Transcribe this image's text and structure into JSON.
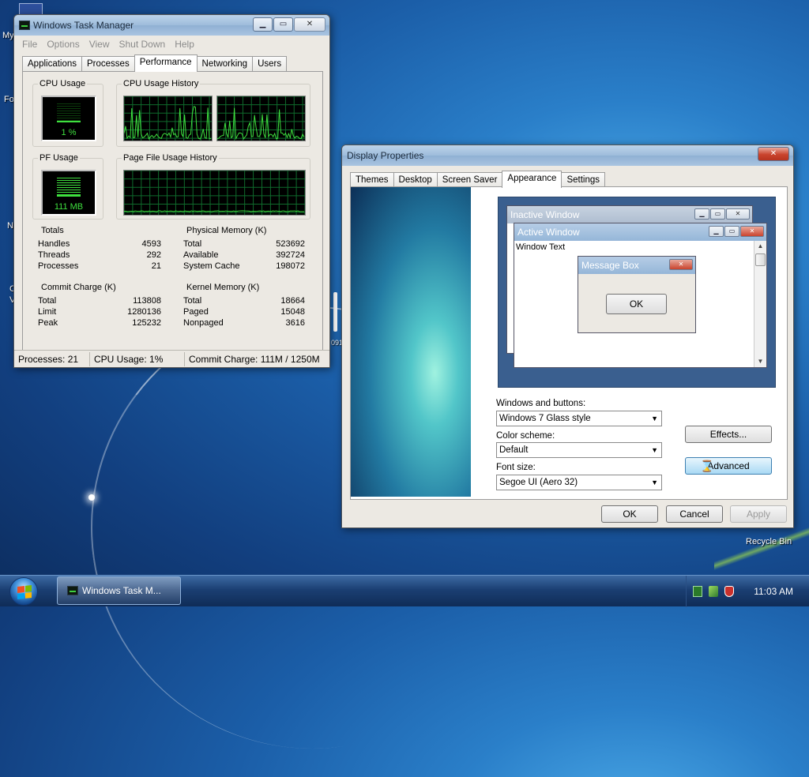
{
  "desktop": {
    "side_labels": [
      "My",
      "Fo",
      "N",
      "C",
      "V"
    ],
    "gadget_text": "091",
    "recycle_bin": "Recycle Bin"
  },
  "task_manager": {
    "title": "Windows Task Manager",
    "menu": [
      "File",
      "Options",
      "View",
      "Shut Down",
      "Help"
    ],
    "tabs": [
      "Applications",
      "Processes",
      "Performance",
      "Networking",
      "Users"
    ],
    "active_tab": "Performance",
    "cpu_usage_label": "CPU Usage",
    "cpu_usage_value": "1 %",
    "cpu_history_label": "CPU Usage History",
    "pf_usage_label": "PF Usage",
    "pf_usage_value": "111 MB",
    "pf_history_label": "Page File Usage History",
    "totals": {
      "label": "Totals",
      "rows": [
        {
          "k": "Handles",
          "v": "4593"
        },
        {
          "k": "Threads",
          "v": "292"
        },
        {
          "k": "Processes",
          "v": "21"
        }
      ]
    },
    "physical_memory": {
      "label": "Physical Memory (K)",
      "rows": [
        {
          "k": "Total",
          "v": "523692"
        },
        {
          "k": "Available",
          "v": "392724"
        },
        {
          "k": "System Cache",
          "v": "198072"
        }
      ]
    },
    "commit_charge": {
      "label": "Commit Charge (K)",
      "rows": [
        {
          "k": "Total",
          "v": "113808"
        },
        {
          "k": "Limit",
          "v": "1280136"
        },
        {
          "k": "Peak",
          "v": "125232"
        }
      ]
    },
    "kernel_memory": {
      "label": "Kernel Memory (K)",
      "rows": [
        {
          "k": "Total",
          "v": "18664"
        },
        {
          "k": "Paged",
          "v": "15048"
        },
        {
          "k": "Nonpaged",
          "v": "3616"
        }
      ]
    },
    "status": {
      "processes": "Processes: 21",
      "cpu": "CPU Usage: 1%",
      "commit": "Commit Charge: 111M / 1250M"
    }
  },
  "display_properties": {
    "title": "Display Properties",
    "close_symbol": "✕",
    "tabs": [
      "Themes",
      "Desktop",
      "Screen Saver",
      "Appearance",
      "Settings"
    ],
    "active_tab": "Appearance",
    "preview": {
      "inactive_title": "Inactive Window",
      "active_title": "Active Window",
      "window_text": "Window Text",
      "message_title": "Message Box",
      "ok": "OK"
    },
    "windows_buttons_label": "Windows and buttons:",
    "windows_buttons_value": "Windows 7 Glass style",
    "color_scheme_label": "Color scheme:",
    "color_scheme_value": "Default",
    "font_size_label": "Font size:",
    "font_size_value": "Segoe UI (Aero 32)",
    "effects_button": "Effects...",
    "advanced_button": "Advanced",
    "ok_button": "OK",
    "cancel_button": "Cancel",
    "apply_button": "Apply"
  },
  "taskbar": {
    "task_button": "Windows Task M...",
    "clock": "11:03 AM"
  },
  "colors": {
    "graph_line": "#3fe03f",
    "grid": "#0f6b2c"
  }
}
